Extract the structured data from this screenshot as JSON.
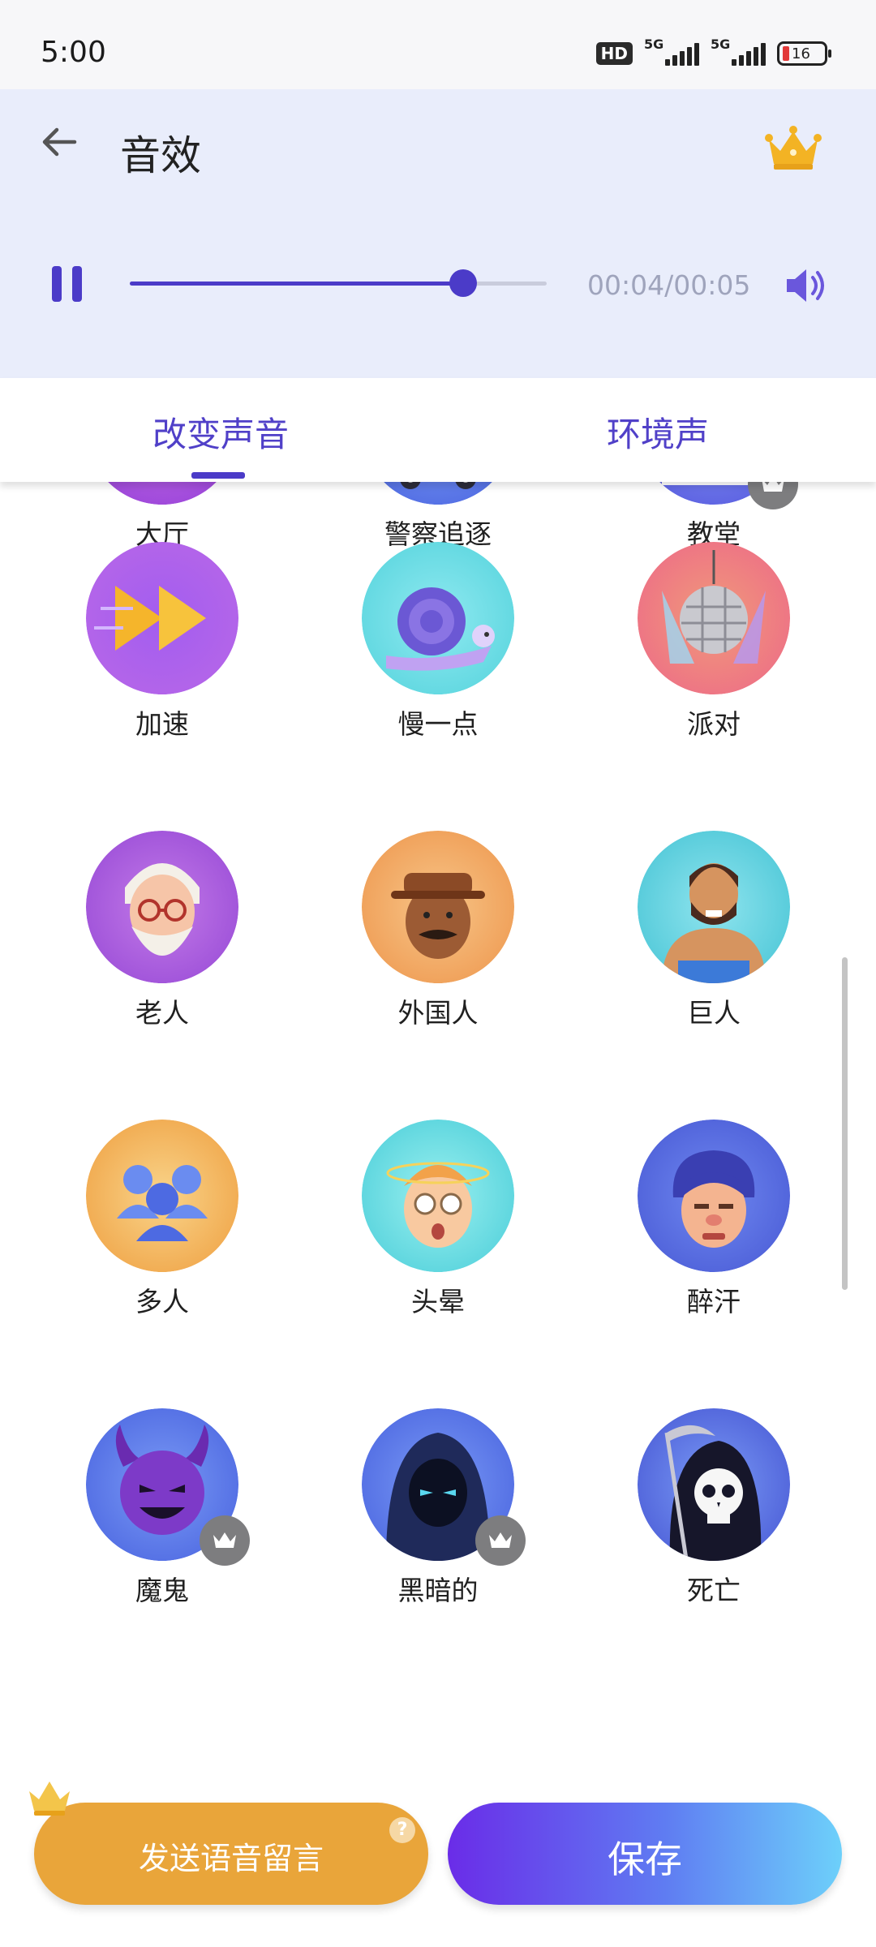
{
  "status_bar": {
    "time": "5:00",
    "hd": "HD",
    "signal1": "5G",
    "signal2": "5G",
    "battery": "16"
  },
  "header": {
    "title": "音效",
    "playback_time": "00:04/00:05",
    "progress": 0.8
  },
  "tabs": [
    {
      "label": "改变声音",
      "active": true
    },
    {
      "label": "环境声",
      "active": false
    }
  ],
  "effects": [
    {
      "label": "大厅",
      "icon": "hall-icon",
      "premium": false
    },
    {
      "label": "警察追逐",
      "icon": "police-car-icon",
      "premium": false
    },
    {
      "label": "教堂",
      "icon": "church-icon",
      "premium": true
    },
    {
      "label": "加速",
      "icon": "fast-forward-icon",
      "premium": false
    },
    {
      "label": "慢一点",
      "icon": "snail-icon",
      "premium": false
    },
    {
      "label": "派对",
      "icon": "disco-ball-icon",
      "premium": false
    },
    {
      "label": "老人",
      "icon": "old-man-icon",
      "premium": false
    },
    {
      "label": "外国人",
      "icon": "foreigner-icon",
      "premium": false
    },
    {
      "label": "巨人",
      "icon": "giant-icon",
      "premium": false
    },
    {
      "label": "多人",
      "icon": "crowd-icon",
      "premium": false
    },
    {
      "label": "头晕",
      "icon": "dizzy-icon",
      "premium": false
    },
    {
      "label": "醉汗",
      "icon": "drunk-icon",
      "premium": false
    },
    {
      "label": "魔鬼",
      "icon": "devil-icon",
      "premium": true
    },
    {
      "label": "黑暗的",
      "icon": "dark-hood-icon",
      "premium": true
    },
    {
      "label": "死亡",
      "icon": "grim-reaper-icon",
      "premium": false
    }
  ],
  "buttons": {
    "voicemail": "发送语音留言",
    "help": "?",
    "save": "保存"
  },
  "colors": {
    "accent": "#4b3bc8",
    "header_bg": "#e9edfb",
    "voicemail_btn": "#e9a53a",
    "premium_badge": "#7d7d7f"
  }
}
